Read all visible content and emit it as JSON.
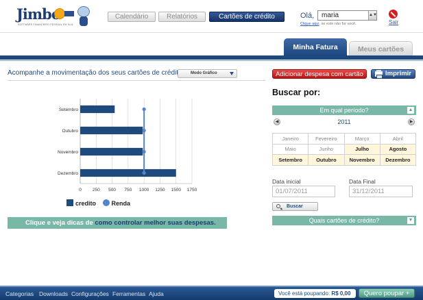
{
  "header": {
    "logo_text": "Jimbo",
    "logo_tagline": "SOFTWARE FINANCEIRO PESSOAL EM SUA",
    "nav": [
      {
        "label": "Calendário",
        "active": false
      },
      {
        "label": "Relatórios",
        "active": false
      },
      {
        "label": "Cartões de crédito",
        "active": true
      }
    ],
    "greeting": "Olá,",
    "user_value": "maria",
    "hint_link": "Clique aqui",
    "hint_rest": ", se este não for você.",
    "logout_label": "Sair"
  },
  "tabs": [
    {
      "label": "Minha Fatura",
      "active": true
    },
    {
      "label": "Meus cartões",
      "active": false
    }
  ],
  "left": {
    "title": "Acompanhe a movimentação dos seus cartões de crédito:",
    "mode_select": "Modo Gráfico",
    "tips_prefix": "Clique e veja dicas de",
    "tips_accent": "como controlar melhor suas despesas."
  },
  "chart_data": {
    "type": "bar",
    "orientation": "horizontal",
    "categories": [
      "Setembro",
      "Outubro",
      "Novembro",
      "Dezembro"
    ],
    "series": [
      {
        "name": "credito",
        "type": "bar",
        "values": [
          540,
          980,
          980,
          1500
        ]
      },
      {
        "name": "Renda",
        "type": "line",
        "values": [
          1000,
          1000,
          1000,
          1000
        ]
      }
    ],
    "xlim": [
      0,
      1750
    ],
    "xticks": [
      0,
      250,
      500,
      750,
      1000,
      1250,
      1500,
      1750
    ],
    "grid": true,
    "legend": "bottom",
    "colors": {
      "credito": "#1f4a7e",
      "Renda": "#5585c8"
    }
  },
  "right": {
    "add_button": "Adicionar despesa com cartão",
    "print_button": "Imprimir",
    "search_title": "Buscar por:",
    "period_bar": "Em qual período?",
    "year": "2011",
    "months": [
      [
        {
          "label": "Janeiro",
          "sel": false
        },
        {
          "label": "Fevereiro",
          "sel": false
        },
        {
          "label": "Março",
          "sel": false
        },
        {
          "label": "Abril",
          "sel": false
        }
      ],
      [
        {
          "label": "Maio",
          "sel": false
        },
        {
          "label": "Junho",
          "sel": false
        },
        {
          "label": "Julho",
          "sel": true
        },
        {
          "label": "Agosto",
          "sel": true
        }
      ],
      [
        {
          "label": "Setembro",
          "sel": true
        },
        {
          "label": "Outubro",
          "sel": true
        },
        {
          "label": "Novembro",
          "sel": true
        },
        {
          "label": "Dezembro",
          "sel": true
        }
      ]
    ],
    "start_label": "Data inicial",
    "start_value": "01/07/2011",
    "end_label": "Data Final",
    "end_value": "31/12/2011",
    "search_button": "Buscar",
    "cards_bar": "Quais cartões de crédito?"
  },
  "footer": {
    "links": [
      "Categorias",
      "Downloads",
      "Configurações",
      "Ferramentas",
      "Ajuda"
    ],
    "savings_label": "Você está poupando:",
    "savings_value": "R$ 0,00",
    "save_button": "Quero poupar +"
  },
  "colors": {
    "navy": "#1f4a7e",
    "teal": "#79b8a7",
    "red": "#c81e1e"
  }
}
